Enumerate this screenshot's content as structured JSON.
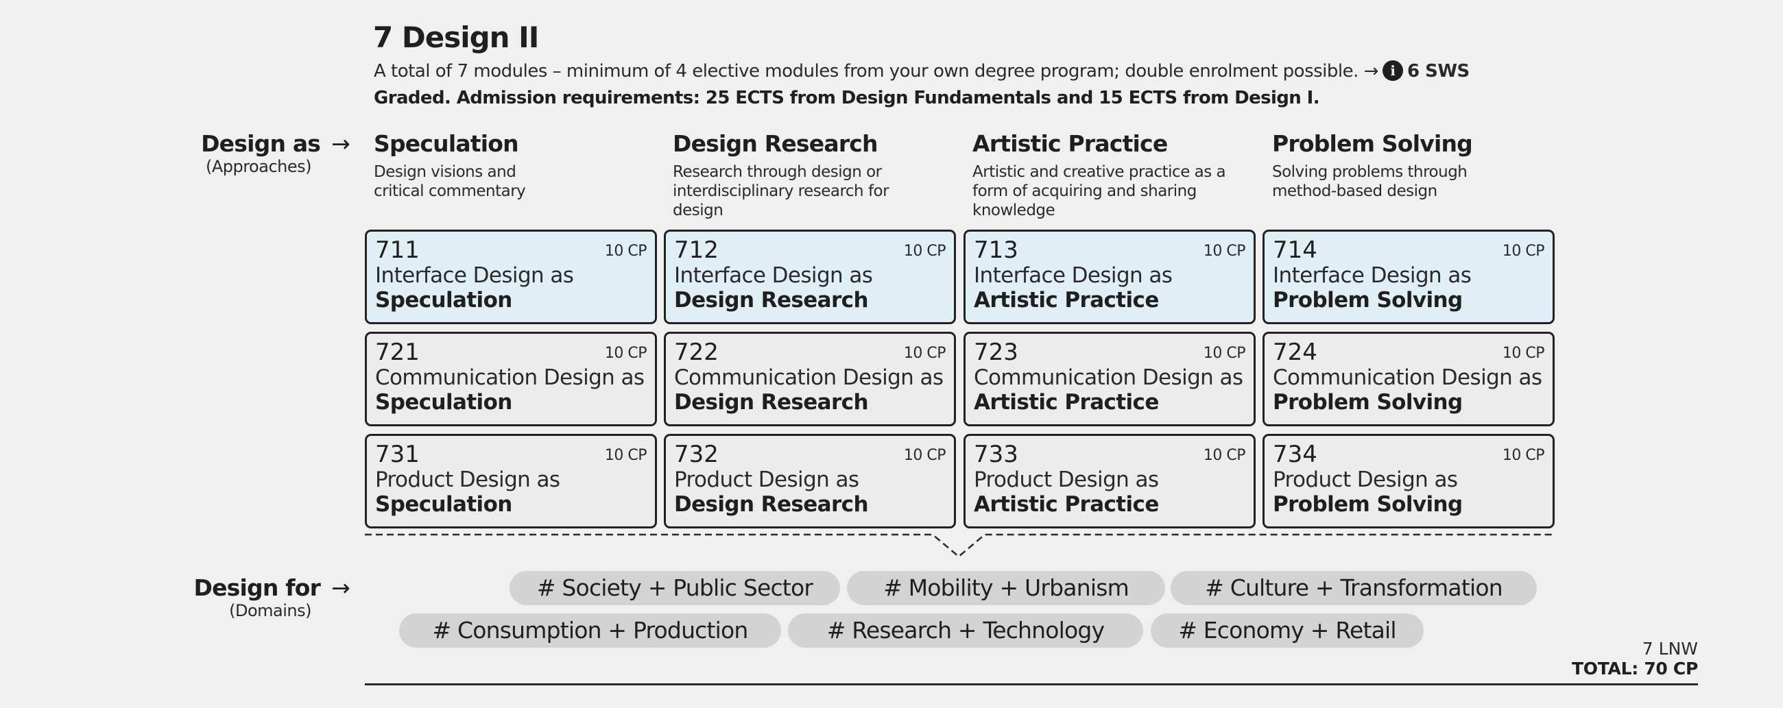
{
  "header": {
    "title": "7 Design II",
    "description": "A total of 7 modules – minimum of 4 elective modules from your own degree program; double enrolment possible. →",
    "info_icon": "i",
    "sws": "6 SWS",
    "requirements": "Graded. Admission requirements: 25 ECTS from Design Fundamentals and 15 ECTS from Design I."
  },
  "design_as": {
    "label": "Design as",
    "arrow": "→",
    "sublabel": "(Approaches)"
  },
  "approaches": [
    {
      "name": "Speculation",
      "text": "Design visions and critical commentary"
    },
    {
      "name": "Design Research",
      "text": "Research through design or interdisciplinary research for design"
    },
    {
      "name": "Artistic Practice",
      "text": "Artistic and creative practice as a form of acquiring and sharing knowledge"
    },
    {
      "name": "Problem Solving",
      "text": "Solving problems through method-based design"
    }
  ],
  "modules": [
    [
      {
        "code": "711",
        "cp": "10 CP",
        "line1": "Interface Design as",
        "line2": "Speculation"
      },
      {
        "code": "712",
        "cp": "10 CP",
        "line1": "Interface Design as",
        "line2": "Design Research"
      },
      {
        "code": "713",
        "cp": "10 CP",
        "line1": "Interface Design as",
        "line2": "Artistic Practice"
      },
      {
        "code": "714",
        "cp": "10 CP",
        "line1": "Interface Design as",
        "line2": "Problem Solving"
      }
    ],
    [
      {
        "code": "721",
        "cp": "10 CP",
        "line1": "Communication Design as",
        "line2": "Speculation"
      },
      {
        "code": "722",
        "cp": "10 CP",
        "line1": "Communication Design as",
        "line2": "Design Research"
      },
      {
        "code": "723",
        "cp": "10 CP",
        "line1": "Communication Design as",
        "line2": "Artistic Practice"
      },
      {
        "code": "724",
        "cp": "10 CP",
        "line1": "Communication Design as",
        "line2": "Problem Solving"
      }
    ],
    [
      {
        "code": "731",
        "cp": "10 CP",
        "line1": "Product Design as",
        "line2": "Speculation"
      },
      {
        "code": "732",
        "cp": "10 CP",
        "line1": "Product Design as",
        "line2": "Design Research"
      },
      {
        "code": "733",
        "cp": "10 CP",
        "line1": "Product Design as",
        "line2": "Artistic Practice"
      },
      {
        "code": "734",
        "cp": "10 CP",
        "line1": "Product Design as",
        "line2": "Problem Solving"
      }
    ]
  ],
  "design_for": {
    "label": "Design for",
    "arrow": "→",
    "sublabel": "(Domains)"
  },
  "domains": [
    "# Society + Public Sector",
    "# Mobility + Urbanism",
    "# Culture + Transformation",
    "# Consumption + Production",
    "# Research + Technology",
    "# Economy + Retail"
  ],
  "totals": {
    "lnw": "7 LNW",
    "total": "TOTAL: 70 CP"
  },
  "colors": {
    "background": "#f0f0f0",
    "interface_card": "#e0eef5",
    "default_card": "#ececec",
    "tag": "#d3d3d3",
    "text": "#1f1f1f"
  }
}
